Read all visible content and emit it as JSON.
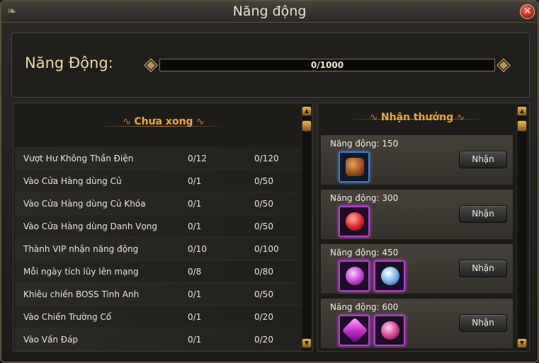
{
  "window": {
    "title": "Năng động",
    "close_symbol": "✕"
  },
  "progress": {
    "label": "Năng Động:",
    "current": 0,
    "max": 1000,
    "text": "0/1000"
  },
  "tasks_section": {
    "title": "Chưa xong",
    "rows": [
      {
        "name": "Vượt Hư Không Thần Điện",
        "progress": "0/12",
        "points": "0/120"
      },
      {
        "name": "Vào Cửa Hàng dùng Củ",
        "progress": "0/1",
        "points": "0/50"
      },
      {
        "name": "Vào Cửa Hàng dùng Củ Khóa",
        "progress": "0/1",
        "points": "0/50"
      },
      {
        "name": "Vào Cửa Hàng dùng Danh Vọng",
        "progress": "0/1",
        "points": "0/50"
      },
      {
        "name": "Thành VIP nhận năng động",
        "progress": "0/10",
        "points": "0/100"
      },
      {
        "name": "Mỗi ngày tích lũy lên mạng",
        "progress": "0/8",
        "points": "0/80"
      },
      {
        "name": "Khiêu chiến BOSS Tinh Anh",
        "progress": "0/1",
        "points": "0/50"
      },
      {
        "name": "Vào Chiến Trường Cổ",
        "progress": "0/1",
        "points": "0/20"
      },
      {
        "name": "Vào Vấn Đáp",
        "progress": "0/1",
        "points": "0/20"
      }
    ]
  },
  "rewards_section": {
    "title": "Nhận thưởng",
    "button_label": "Nhận",
    "tiers": [
      {
        "label": "Năng động: 150",
        "items": [
          "bag-item-icon"
        ]
      },
      {
        "label": "Năng động: 300",
        "items": [
          "red-orb-icon"
        ]
      },
      {
        "label": "Năng động: 450",
        "items": [
          "violet-orb-icon",
          "ice-orb-icon"
        ]
      },
      {
        "label": "Năng động: 600",
        "items": [
          "purple-gem-icon",
          "pink-orb-icon"
        ]
      }
    ]
  },
  "colors": {
    "accent_gold": "#f0a63a",
    "rare_blue": "#3f7cd0",
    "epic_purple": "#b93ad4",
    "close_red": "#e0302a"
  }
}
